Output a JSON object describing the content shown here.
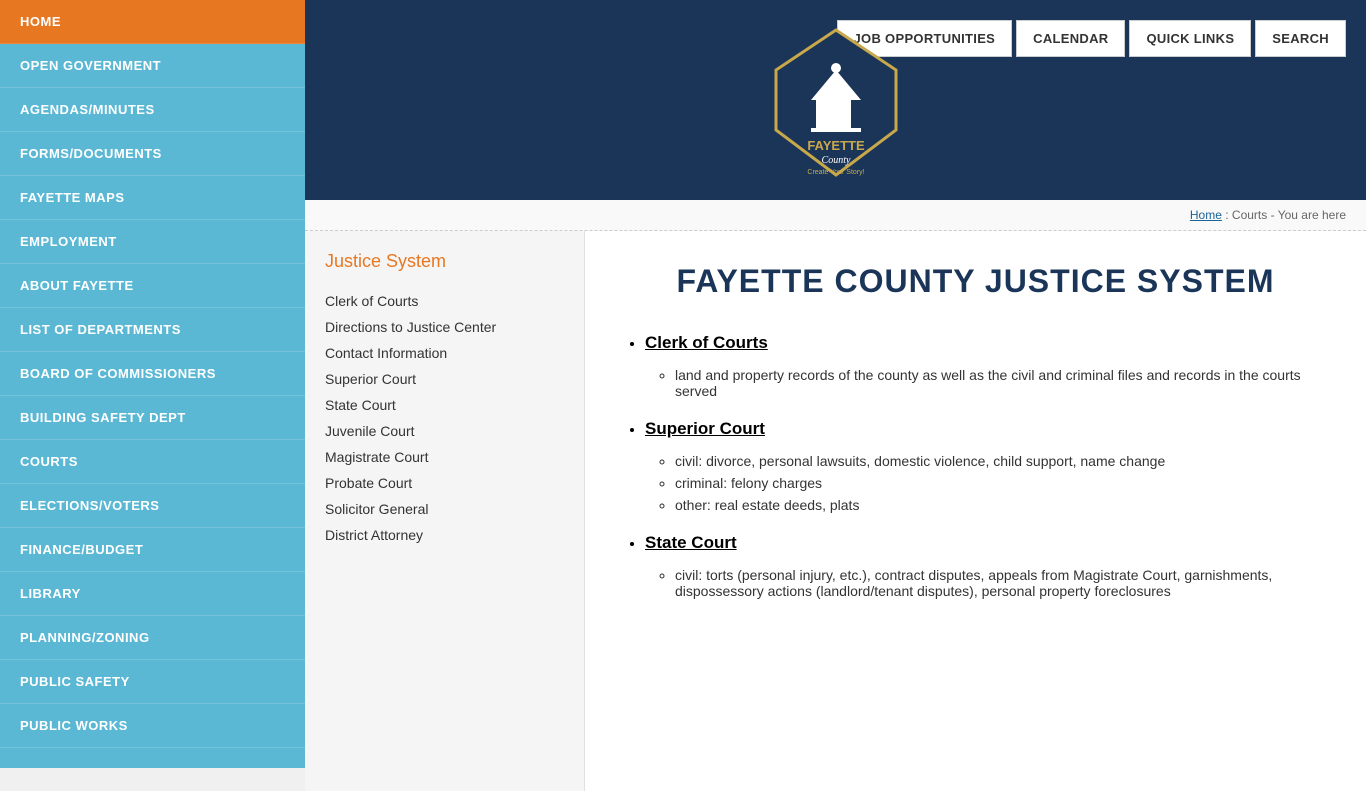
{
  "sidebar": {
    "items": [
      {
        "label": "HOME",
        "active": true
      },
      {
        "label": "OPEN GOVERNMENT",
        "active": false
      },
      {
        "label": "AGENDAS/MINUTES",
        "active": false
      },
      {
        "label": "FORMS/DOCUMENTS",
        "active": false
      },
      {
        "label": "FAYETTE MAPS",
        "active": false
      },
      {
        "label": "EMPLOYMENT",
        "active": false
      },
      {
        "label": "ABOUT FAYETTE",
        "active": false
      },
      {
        "label": "LIST OF DEPARTMENTS",
        "active": false
      },
      {
        "label": "BOARD OF COMMISSIONERS",
        "active": false
      },
      {
        "label": "BUILDING SAFETY DEPT",
        "active": false
      },
      {
        "label": "COURTS",
        "active": false
      },
      {
        "label": "ELECTIONS/VOTERS",
        "active": false
      },
      {
        "label": "FINANCE/BUDGET",
        "active": false
      },
      {
        "label": "LIBRARY",
        "active": false
      },
      {
        "label": "PLANNING/ZONING",
        "active": false
      },
      {
        "label": "PUBLIC SAFETY",
        "active": false
      },
      {
        "label": "PUBLIC WORKS",
        "active": false
      }
    ]
  },
  "header": {
    "nav_buttons": [
      "JOB OPPORTUNITIES",
      "CALENDAR",
      "QUICK LINKS",
      "SEARCH"
    ],
    "logo_line1": "FAYETTE",
    "logo_line2": "County",
    "logo_tagline": "Create Your Story!"
  },
  "breadcrumb": {
    "home_label": "Home",
    "trail": ": Courts -",
    "current": "You are here"
  },
  "secondary_nav": {
    "title": "Justice System",
    "links": [
      "Clerk of Courts",
      "Directions to Justice Center",
      "Contact Information",
      "Superior Court",
      "State Court",
      "Juvenile Court",
      "Magistrate Court",
      "Probate Court",
      "Solicitor General",
      "District Attorney"
    ]
  },
  "main_content": {
    "page_title": "FAYETTE COUNTY JUSTICE SYSTEM",
    "sections": [
      {
        "title": "Clerk of Courts",
        "items": [
          "land and property records of the county as well as the civil and criminal files and records in the courts served"
        ]
      },
      {
        "title": "Superior Court",
        "items": [
          "civil: divorce, personal lawsuits, domestic violence, child support, name change",
          "criminal: felony charges",
          "other: real estate deeds, plats"
        ]
      },
      {
        "title": "State Court",
        "items": [
          "civil: torts (personal injury, etc.), contract disputes, appeals from Magistrate Court, garnishments, dispossessory actions (landlord/tenant disputes), personal property foreclosures"
        ]
      }
    ]
  }
}
